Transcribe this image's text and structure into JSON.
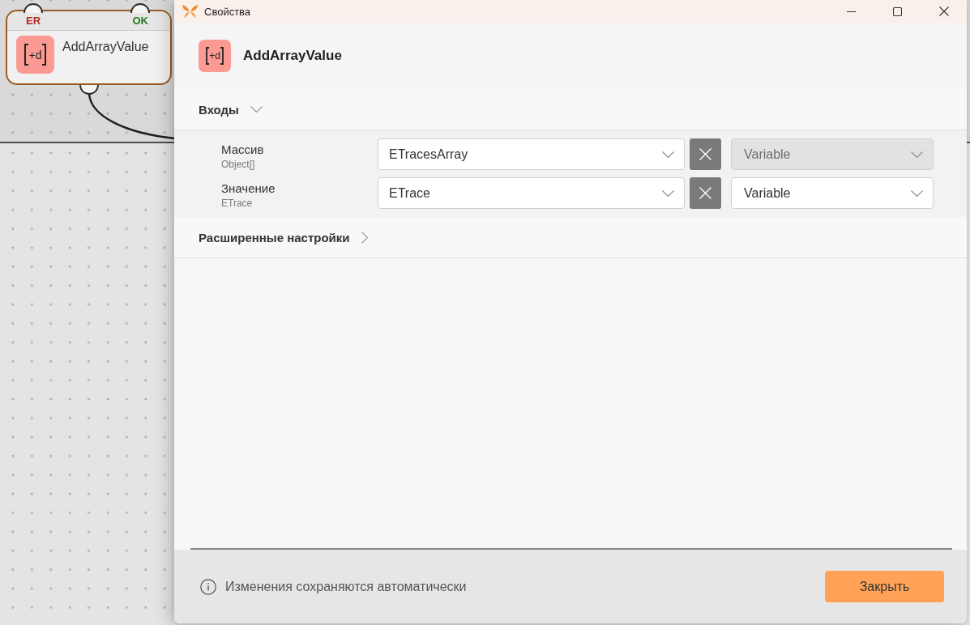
{
  "canvas": {
    "node": {
      "icon_text": "+d",
      "title": "AddArrayValue",
      "ports": [
        {
          "label": "ER",
          "color": "#b0281e"
        },
        {
          "label": "OK",
          "color": "#237a1c"
        }
      ]
    }
  },
  "dialog": {
    "title": "Свойства",
    "header": {
      "icon_text": "+d",
      "title": "AddArrayValue"
    },
    "sections": [
      {
        "title": "Входы",
        "expanded": true,
        "inputs": [
          {
            "name": "Массив",
            "type": "Object[]",
            "value": "ETracesArray",
            "mode": {
              "value": "Variable",
              "disabled": true
            }
          },
          {
            "name": "Значение",
            "type": "ETrace",
            "value": "ETrace",
            "mode": {
              "value": "Variable",
              "disabled": false
            }
          }
        ]
      },
      {
        "title": "Расширенные настройки",
        "expanded": false
      }
    ],
    "footer": {
      "note": "Изменения сохраняются автоматически",
      "button": "Закрыть"
    }
  }
}
